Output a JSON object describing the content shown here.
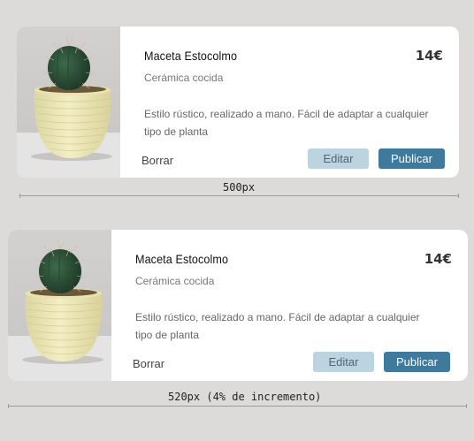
{
  "cards": [
    {
      "title": "Maceta Estocolmo",
      "price": "14€",
      "subtitle": "Cerámica cocida",
      "description": "Estilo rústico, realizado a mano. Fácil de adaptar a cualquier tipo de planta",
      "delete_label": "Borrar",
      "edit_label": "Editar",
      "publish_label": "Publicar"
    },
    {
      "title": "Maceta Estocolmo",
      "price": "14€",
      "subtitle": "Cerámica cocida",
      "description": "Estilo rústico, realizado a mano. Fácil de adaptar a cualquier tipo de planta",
      "delete_label": "Borrar",
      "edit_label": "Editar",
      "publish_label": "Publicar"
    }
  ],
  "annotations": {
    "width1": "500px",
    "width2": "520px (4% de incremento)"
  },
  "colors": {
    "background": "#dcdbd9",
    "card": "#ffffff",
    "edit_button": "#bcd3e0",
    "publish_button": "#3f7a9c",
    "pot": "#f0ebbd",
    "cactus": "#2c4a34"
  },
  "icons": [
    "cactus-pot-photo"
  ]
}
